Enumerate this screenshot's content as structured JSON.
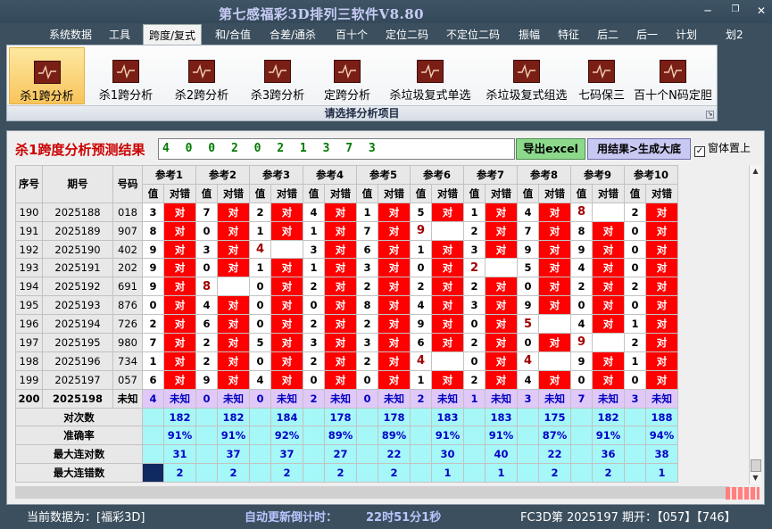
{
  "window": {
    "title": "第七感福彩3D排列三软件V8.80",
    "controls": [
      "─",
      "❐",
      "✕"
    ]
  },
  "menubar": {
    "items": [
      "系统数据",
      "工具",
      "跨度/复式",
      "和/合值",
      "合差/通杀",
      "百十个",
      "定位二码",
      "不定位二码",
      "振幅",
      "特征",
      "后二",
      "后一",
      "计划",
      "划2"
    ],
    "active": "跨度/复式"
  },
  "ribbon": {
    "buttons": [
      "杀1跨分析",
      "杀1跨分析",
      "杀2跨分析",
      "杀3跨分析",
      "定跨分析",
      "杀垃圾复式单选",
      "杀垃圾复式组选",
      "七码保三",
      "百十个N码定胆"
    ],
    "active_index": 0,
    "caption": "请选择分析项目",
    "icon": "chart-line-icon"
  },
  "result": {
    "label": "杀1跨度分析预测结果",
    "value": "4 0 0 2 0 2 1 3 7 3",
    "export_button": "导出excel",
    "generate_button": "用结果>生成大底",
    "pin_label": "窗体置上",
    "pin_checked": true
  },
  "table": {
    "header1": [
      "序号",
      "期号",
      "号码"
    ],
    "groups": [
      "参考1",
      "参考2",
      "参考3",
      "参考4",
      "参考5",
      "参考6",
      "参考7",
      "参考8",
      "参考9",
      "参考10"
    ],
    "subheaders": [
      "值",
      "对错"
    ],
    "hit_label": "对",
    "rows": [
      {
        "seq": "190",
        "period": "2025188",
        "code": "018",
        "vals": [
          "3",
          "7",
          "2",
          "4",
          "1",
          "5",
          "1",
          "4",
          "8",
          "2"
        ],
        "hits": [
          1,
          1,
          1,
          1,
          1,
          1,
          1,
          1,
          0,
          1
        ],
        "hl": [
          0,
          0,
          0,
          0,
          0,
          0,
          0,
          0,
          1,
          0
        ]
      },
      {
        "seq": "191",
        "period": "2025189",
        "code": "907",
        "vals": [
          "8",
          "0",
          "1",
          "1",
          "7",
          "9",
          "2",
          "7",
          "8",
          "0"
        ],
        "hits": [
          1,
          1,
          1,
          1,
          1,
          0,
          1,
          1,
          1,
          1
        ],
        "hl": [
          0,
          0,
          0,
          0,
          0,
          1,
          0,
          0,
          0,
          0
        ]
      },
      {
        "seq": "192",
        "period": "2025190",
        "code": "402",
        "vals": [
          "9",
          "3",
          "4",
          "3",
          "6",
          "1",
          "3",
          "9",
          "9",
          "0"
        ],
        "hits": [
          1,
          1,
          0,
          1,
          1,
          1,
          1,
          1,
          1,
          1
        ],
        "hl": [
          0,
          0,
          1,
          0,
          0,
          0,
          0,
          0,
          0,
          0
        ]
      },
      {
        "seq": "193",
        "period": "2025191",
        "code": "202",
        "vals": [
          "9",
          "0",
          "1",
          "1",
          "3",
          "0",
          "2",
          "5",
          "4",
          "0"
        ],
        "hits": [
          1,
          1,
          1,
          1,
          1,
          1,
          0,
          1,
          1,
          1
        ],
        "hl": [
          0,
          0,
          0,
          0,
          0,
          0,
          1,
          0,
          0,
          0
        ]
      },
      {
        "seq": "194",
        "period": "2025192",
        "code": "691",
        "vals": [
          "9",
          "8",
          "0",
          "2",
          "2",
          "2",
          "2",
          "0",
          "2",
          "2"
        ],
        "hits": [
          1,
          0,
          1,
          1,
          1,
          1,
          1,
          1,
          1,
          1
        ],
        "hl": [
          0,
          1,
          0,
          0,
          0,
          0,
          0,
          0,
          0,
          0
        ]
      },
      {
        "seq": "195",
        "period": "2025193",
        "code": "876",
        "vals": [
          "0",
          "4",
          "0",
          "0",
          "8",
          "4",
          "3",
          "9",
          "0",
          "0"
        ],
        "hits": [
          1,
          1,
          1,
          1,
          1,
          1,
          1,
          1,
          1,
          1
        ],
        "hl": [
          0,
          0,
          0,
          0,
          0,
          0,
          0,
          0,
          0,
          0
        ]
      },
      {
        "seq": "196",
        "period": "2025194",
        "code": "726",
        "vals": [
          "2",
          "6",
          "0",
          "2",
          "2",
          "9",
          "0",
          "5",
          "4",
          "1"
        ],
        "hits": [
          1,
          1,
          1,
          1,
          1,
          1,
          1,
          0,
          1,
          1
        ],
        "hl": [
          0,
          0,
          0,
          0,
          0,
          0,
          0,
          1,
          0,
          0
        ]
      },
      {
        "seq": "197",
        "period": "2025195",
        "code": "980",
        "vals": [
          "7",
          "2",
          "5",
          "3",
          "3",
          "6",
          "2",
          "0",
          "9",
          "2"
        ],
        "hits": [
          1,
          1,
          1,
          1,
          1,
          1,
          1,
          1,
          0,
          1
        ],
        "hl": [
          0,
          0,
          0,
          0,
          0,
          0,
          0,
          0,
          1,
          0
        ]
      },
      {
        "seq": "198",
        "period": "2025196",
        "code": "734",
        "vals": [
          "1",
          "2",
          "0",
          "2",
          "2",
          "4",
          "0",
          "4",
          "9",
          "1"
        ],
        "hits": [
          1,
          1,
          1,
          1,
          1,
          0,
          1,
          0,
          1,
          1
        ],
        "hl": [
          0,
          0,
          0,
          0,
          0,
          1,
          0,
          1,
          0,
          0
        ]
      },
      {
        "seq": "199",
        "period": "2025197",
        "code": "057",
        "vals": [
          "6",
          "9",
          "4",
          "0",
          "0",
          "1",
          "2",
          "4",
          "0",
          "0"
        ],
        "hits": [
          1,
          1,
          1,
          1,
          1,
          1,
          1,
          1,
          1,
          1
        ],
        "hl": [
          0,
          0,
          0,
          0,
          0,
          0,
          0,
          0,
          0,
          0
        ]
      }
    ],
    "last_row": {
      "seq": "200",
      "period": "2025198",
      "code": "未知",
      "vals": [
        "4",
        "0",
        "0",
        "2",
        "0",
        "2",
        "1",
        "3",
        "7",
        "3"
      ],
      "unknown": "未知"
    },
    "stats": [
      {
        "label": "对次数",
        "vals": [
          "182",
          "182",
          "184",
          "178",
          "178",
          "183",
          "183",
          "175",
          "182",
          "188"
        ]
      },
      {
        "label": "准确率",
        "vals": [
          "91%",
          "91%",
          "92%",
          "89%",
          "89%",
          "91%",
          "91%",
          "87%",
          "91%",
          "94%"
        ]
      },
      {
        "label": "最大连对数",
        "vals": [
          "31",
          "37",
          "37",
          "27",
          "22",
          "30",
          "40",
          "22",
          "36",
          "38"
        ]
      },
      {
        "label": "最大连错数",
        "vals": [
          "2",
          "2",
          "2",
          "2",
          "2",
          "1",
          "1",
          "2",
          "2",
          "1"
        ]
      }
    ]
  },
  "statusbar": {
    "data_label": "当前数据为：[福彩3D]",
    "countdown_label": "自动更新倒计时：",
    "countdown_value": "22时51分1秒",
    "lottery_info": "FC3D第 2025197 期开：【057】【746】"
  },
  "colors": {
    "hit": "#ff0000",
    "stat_bg": "#a6f7f7",
    "unknown_bg": "#e0c8f8",
    "title": "#c8ccf4",
    "result_label": "#cc0000",
    "result_digits": "#007a00"
  }
}
